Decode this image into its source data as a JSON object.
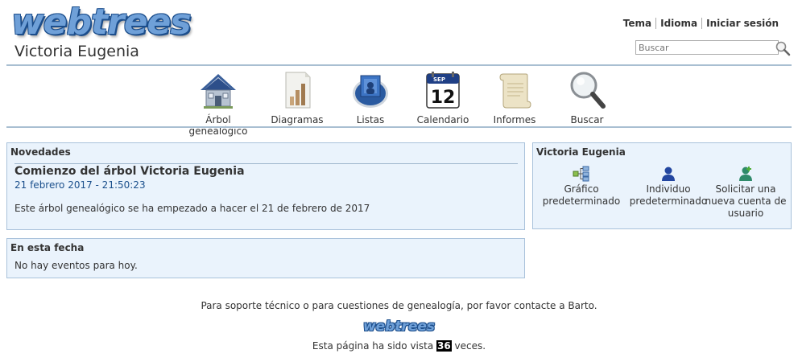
{
  "header": {
    "logo_text": "webtrees",
    "tree_title": "Victoria Eugenia",
    "menu": [
      "Tema",
      "Idioma",
      "Iniciar sesión"
    ],
    "search_placeholder": "Buscar"
  },
  "nav": [
    {
      "label": "Árbol genealógico",
      "icon": "house-icon"
    },
    {
      "label": "Diagramas",
      "icon": "chart-icon"
    },
    {
      "label": "Listas",
      "icon": "lists-icon"
    },
    {
      "label": "Calendario",
      "icon": "calendar-icon"
    },
    {
      "label": "Informes",
      "icon": "scroll-icon"
    },
    {
      "label": "Buscar",
      "icon": "magnifier-icon"
    }
  ],
  "calendar_icon": {
    "month": "SEP",
    "day": "12"
  },
  "news": {
    "heading": "Novedades",
    "title": "Comienzo del árbol Victoria Eugenia",
    "date": "21 febrero 2017 - 21:50:23",
    "text": "Este árbol genealógico se ha empezado a hacer el 21 de febrero de 2017"
  },
  "today": {
    "heading": "En esta fecha",
    "text": "No hay eventos para hoy."
  },
  "favorites": {
    "heading": "Victoria Eugenia",
    "items": [
      {
        "line1": "Gráfico",
        "line2": "predeterminado",
        "line3": ""
      },
      {
        "line1": "Individuo",
        "line2": "predeterminado",
        "line3": ""
      },
      {
        "line1": "Solicitar una",
        "line2": "nueva cuenta de",
        "line3": "usuario"
      }
    ]
  },
  "footer": {
    "contact": "Para soporte técnico o para cuestiones de genealogía, por favor contacte a Barto.",
    "logo_text": "webtrees",
    "visits_before": "Esta página ha sido vista ",
    "visits_count": "36",
    "visits_after": " veces."
  },
  "colors": {
    "accent": "#a9bfd2",
    "panel_bg": "#eaf3fc",
    "link": "#1a4f8c"
  }
}
